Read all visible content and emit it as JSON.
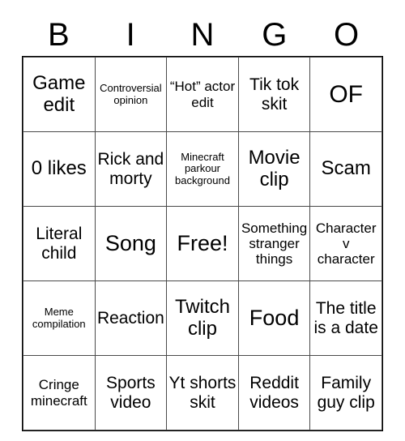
{
  "card": {
    "header_letters": [
      "B",
      "I",
      "N",
      "G",
      "O"
    ],
    "rows": [
      [
        {
          "text": "Game edit",
          "size": "lg"
        },
        {
          "text": "Controversial opinion",
          "size": "xs"
        },
        {
          "text": "“Hot” actor edit",
          "size": "sm"
        },
        {
          "text": "Tik tok skit",
          "size": "md"
        },
        {
          "text": "OF",
          "size": "xxl"
        }
      ],
      [
        {
          "text": "0 likes",
          "size": "lg"
        },
        {
          "text": "Rick and morty",
          "size": "md"
        },
        {
          "text": "Minecraft parkour background",
          "size": "xs"
        },
        {
          "text": "Movie clip",
          "size": "lg"
        },
        {
          "text": "Scam",
          "size": "lg"
        }
      ],
      [
        {
          "text": "Literal child",
          "size": "md"
        },
        {
          "text": "Song",
          "size": "xl"
        },
        {
          "text": "Free!",
          "size": "xl"
        },
        {
          "text": "Something stranger things",
          "size": "sm"
        },
        {
          "text": "Character v character",
          "size": "sm"
        }
      ],
      [
        {
          "text": "Meme compilation",
          "size": "xs"
        },
        {
          "text": "Reaction",
          "size": "md"
        },
        {
          "text": "Twitch clip",
          "size": "lg"
        },
        {
          "text": "Food",
          "size": "xl"
        },
        {
          "text": "The title is a date",
          "size": "md"
        }
      ],
      [
        {
          "text": "Cringe minecraft",
          "size": "sm"
        },
        {
          "text": "Sports video",
          "size": "md"
        },
        {
          "text": "Yt shorts skit",
          "size": "md"
        },
        {
          "text": "Reddit videos",
          "size": "md"
        },
        {
          "text": "Family guy clip",
          "size": "md"
        }
      ]
    ]
  }
}
